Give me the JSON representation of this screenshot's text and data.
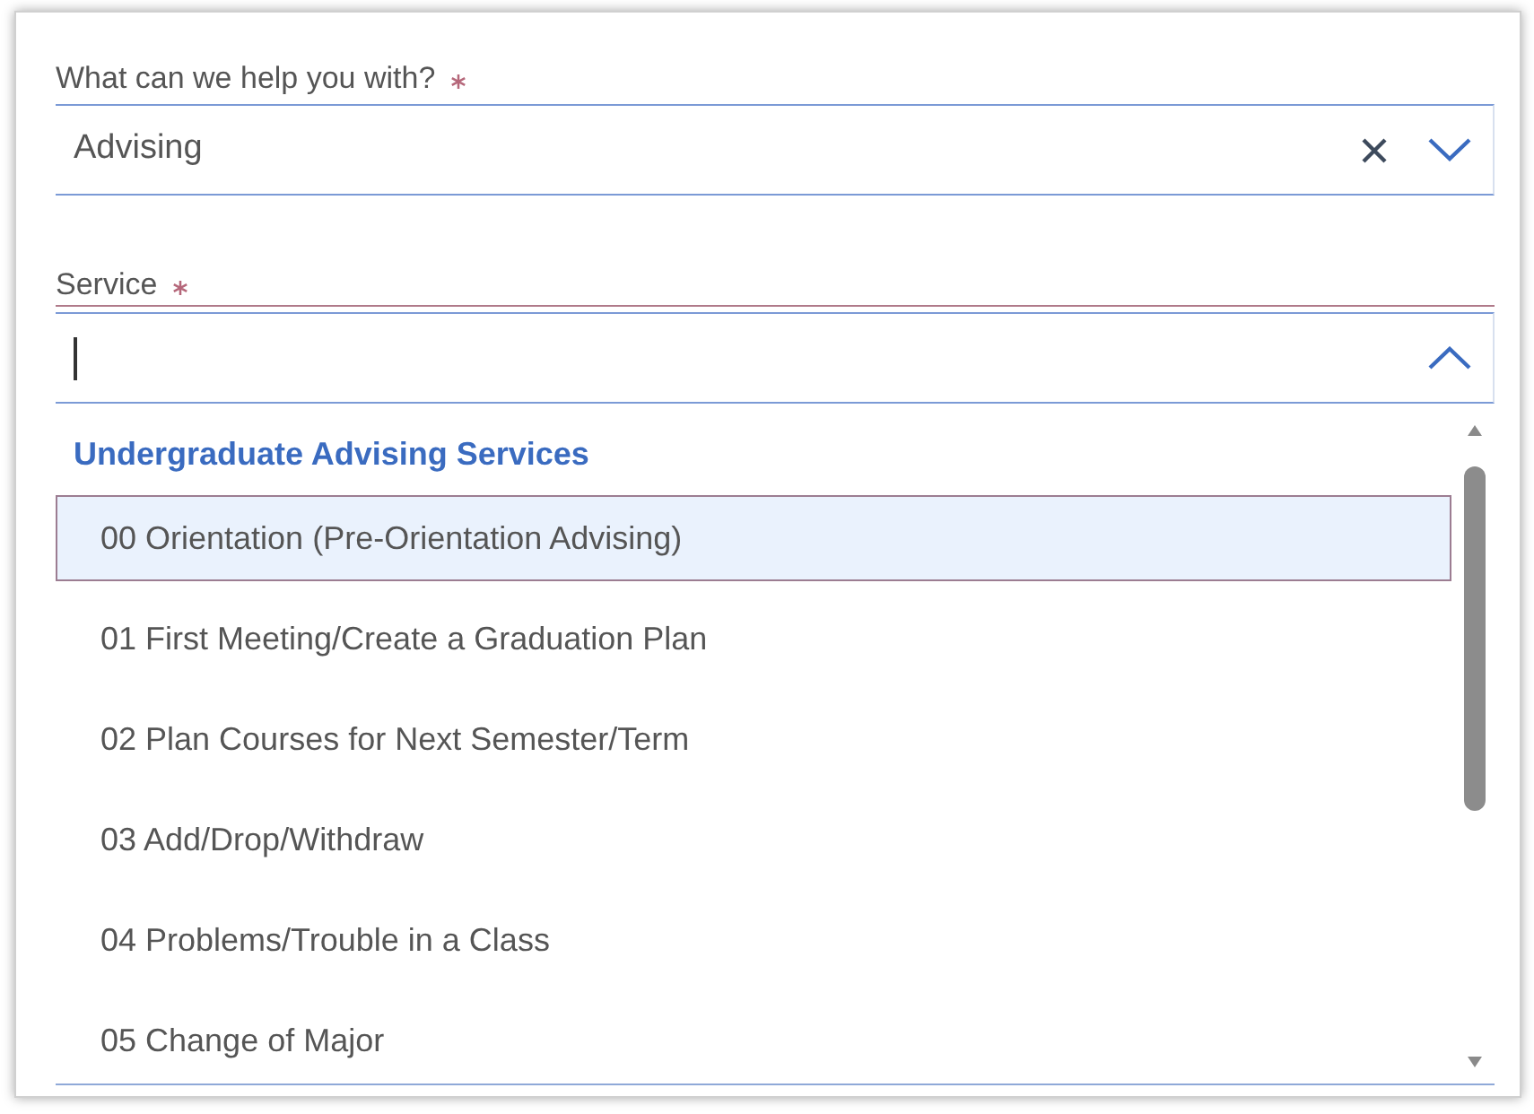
{
  "fields": [
    {
      "label": "What can we help you with?",
      "required": true,
      "value": "Advising",
      "expanded": false,
      "focused": false
    },
    {
      "label": "Service",
      "required": true,
      "expanded": true,
      "focused": true
    }
  ],
  "dropdown": {
    "group": "Undergraduate Advising Services",
    "options": [
      {
        "label": "00 Orientation (Pre-Orientation Advising)",
        "selected": true
      },
      {
        "label": "01 First Meeting/Create a Graduation Plan",
        "selected": false
      },
      {
        "label": "02 Plan Courses for Next Semester/Term",
        "selected": false
      },
      {
        "label": "03 Add/Drop/Withdraw",
        "selected": false
      },
      {
        "label": "04 Problems/Trouble in a Class",
        "selected": false
      },
      {
        "label": "05 Change of Major",
        "selected": false
      }
    ]
  }
}
